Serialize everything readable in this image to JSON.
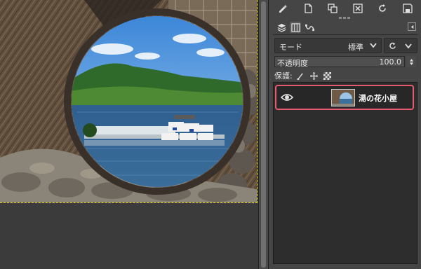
{
  "dock": {
    "toolbar_icons": [
      "edit-icon",
      "new-document-icon",
      "duplicate-icon",
      "delete-icon",
      "refresh-icon",
      "save-icon"
    ],
    "tabs": [
      "layers-tab-icon",
      "channels-tab-icon",
      "paths-tab-icon"
    ],
    "active_tab": "layers-tab-icon",
    "mode": {
      "label": "モード",
      "value": "標準"
    },
    "opacity": {
      "label": "不透明度",
      "value": "100.0",
      "fraction": 1.0
    },
    "lock": {
      "label": "保護:",
      "icons": [
        "brush-lock-icon",
        "move-lock-icon",
        "alpha-lock-icon"
      ]
    },
    "layers": [
      {
        "name": "湯の花小屋",
        "visible": true,
        "selected": true
      }
    ]
  },
  "colors": {
    "highlight": "#e55a6e",
    "selection_outline": "#e8d800",
    "panel_bg": "#454545",
    "list_bg": "#2d2d2d"
  }
}
